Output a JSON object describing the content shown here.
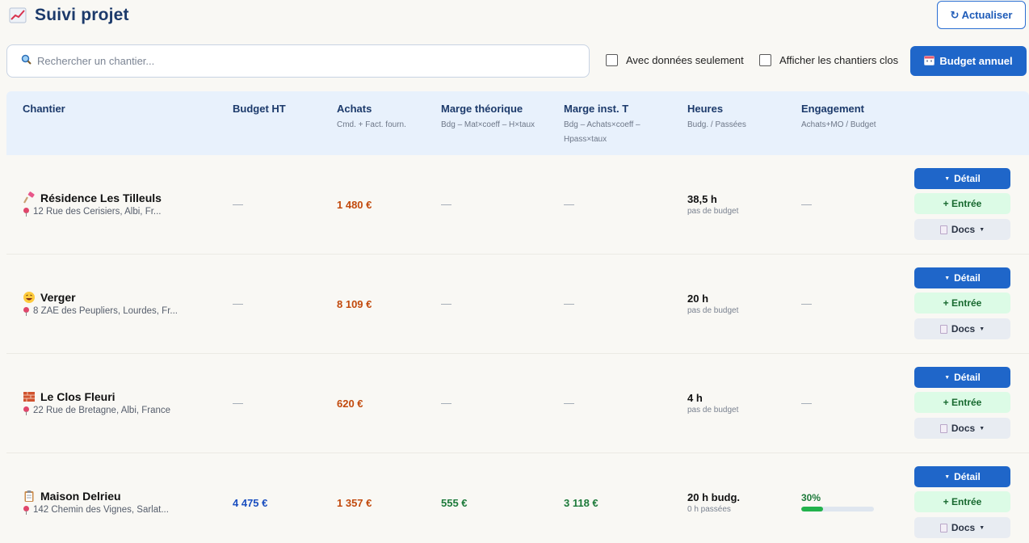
{
  "header": {
    "title": "Suivi projet",
    "refresh_label": "↻ Actualiser"
  },
  "toolbar": {
    "search_placeholder": "Rechercher un chantier...",
    "filter_with_data": "Avec données seulement",
    "filter_closed": "Afficher les chantiers clos",
    "budget_button": "Budget annuel"
  },
  "table": {
    "columns": [
      {
        "label": "Chantier",
        "sub": ""
      },
      {
        "label": "Budget HT",
        "sub": ""
      },
      {
        "label": "Achats",
        "sub": "Cmd. + Fact. fourn."
      },
      {
        "label": "Marge théorique",
        "sub": "Bdg – Mat×coeff – H×taux"
      },
      {
        "label": "Marge inst. T",
        "sub": "Bdg – Achats×coeff –"
      },
      {
        "label": "Heures",
        "sub": "Budg. / Passées"
      },
      {
        "label": "Engagement",
        "sub": "Achats+MO / Budget"
      }
    ],
    "col4_sub2": "Hpass×taux",
    "rows": [
      {
        "icon": "paint-icon",
        "name": "Résidence Les Tilleuls",
        "address": "12 Rue des Cerisiers, Albi, Fr...",
        "budget": "—",
        "achats": "1 480 €",
        "marge_theo": "—",
        "marge_inst": "—",
        "hours": "38,5 h",
        "hours_sub": "pas de budget",
        "engagement": "—"
      },
      {
        "icon": "smile-icon",
        "name": "Verger",
        "address": "8 ZAE des Peupliers, Lourdes, Fr...",
        "budget": "—",
        "achats": "8 109 €",
        "marge_theo": "—",
        "marge_inst": "—",
        "hours": "20 h",
        "hours_sub": "pas de budget",
        "engagement": "—"
      },
      {
        "icon": "brick-icon",
        "name": "Le Clos Fleuri",
        "address": "22 Rue de Bretagne, Albi, France",
        "budget": "—",
        "achats": "620 €",
        "marge_theo": "—",
        "marge_inst": "—",
        "hours": "4 h",
        "hours_sub": "pas de budget",
        "engagement": "—"
      },
      {
        "icon": "clipboard-icon",
        "name": "Maison Delrieu",
        "address": "142 Chemin des Vignes, Sarlat...",
        "budget": "4 475 €",
        "achats": "1 357 €",
        "marge_theo": "555 €",
        "marge_inst": "3 118 €",
        "hours": "20 h budg.",
        "hours_sub": "0 h passées",
        "engagement": "30%",
        "engagement_fill": 0.3
      }
    ],
    "actions": {
      "detail": "Détail",
      "entree": "+ Entrée",
      "docs": "Docs"
    }
  },
  "colors": {
    "accent": "#1f66c9",
    "title": "#1c3a6b",
    "achats": "#c24a0d",
    "budget": "#1b4fc0",
    "positive": "#1d7a3a",
    "progress": "#22b24c"
  }
}
